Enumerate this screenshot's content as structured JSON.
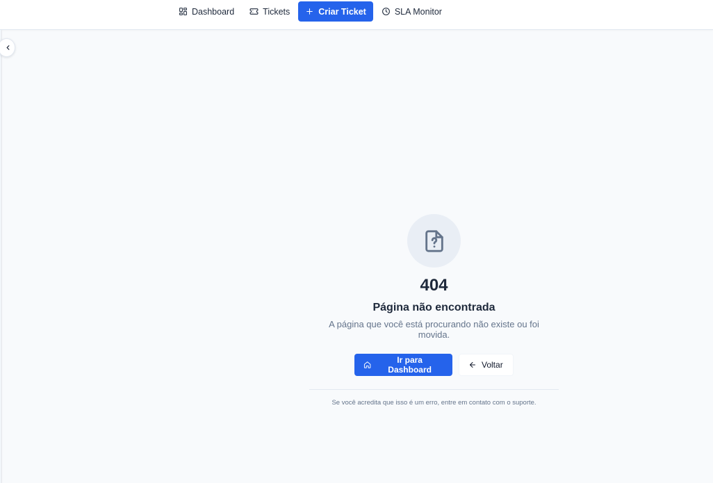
{
  "nav": {
    "items": [
      {
        "label": "Dashboard",
        "icon": "dashboard-icon"
      },
      {
        "label": "Tickets",
        "icon": "ticket-icon"
      },
      {
        "label": "Criar Ticket",
        "icon": "plus-icon"
      },
      {
        "label": "SLA Monitor",
        "icon": "clock-icon"
      }
    ]
  },
  "sidebar": {
    "collapse_icon": "chevron-left-icon"
  },
  "error": {
    "icon": "file-question-icon",
    "code": "404",
    "title": "Página não encontrada",
    "description": "A página que você está procurando não existe ou foi movida.",
    "primary_button": "Ir para Dashboard",
    "secondary_button": "Voltar",
    "support_text": "Se você acredita que isso é um erro, entre em contato com o suporte."
  },
  "colors": {
    "accent": "#2563eb",
    "background": "#f8fafc",
    "text": "#1e293b",
    "muted": "#64748b"
  }
}
